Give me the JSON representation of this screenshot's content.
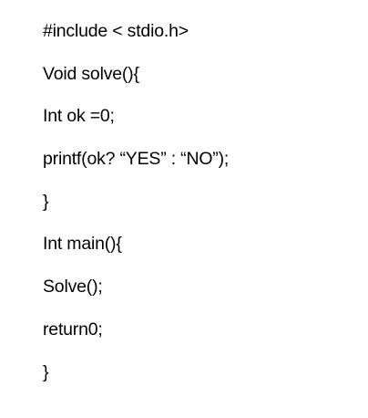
{
  "document": {
    "lines": [
      "#include < stdio.h>",
      "Void solve(){",
      "Int ok =0;",
      "printf(ok? “YES” : “NO”);",
      "}",
      "Int main(){",
      "Solve();",
      "return0;",
      "}"
    ]
  }
}
